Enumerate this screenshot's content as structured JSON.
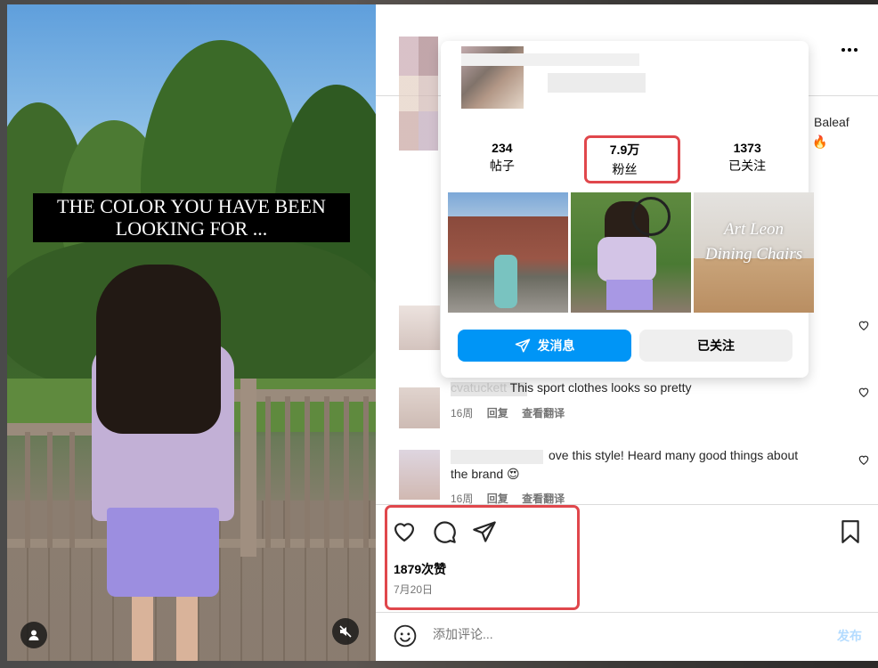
{
  "caption": {
    "line1": "THE COLOR YOU HAVE BEEN",
    "line2": "LOOKING FOR ..."
  },
  "media_buttons": {
    "tag_icon": "person-icon",
    "mute_icon": "speaker-muted-icon"
  },
  "header": {
    "more_icon": "more-dots-icon"
  },
  "hover_card": {
    "stats": [
      {
        "num": "234",
        "label": "帖子"
      },
      {
        "num": "7.9万",
        "label": "粉丝"
      },
      {
        "num": "1373",
        "label": "已关注"
      }
    ],
    "thumb3_line1": "Art Leon",
    "thumb3_line2": "Dining Chairs",
    "message_button": "发消息",
    "following_button": "已关注"
  },
  "comments": {
    "partial_right": "Baleaf",
    "c1_text": "This sport clothes looks so pretty",
    "c1_user_prefix": "cvatuckett",
    "c1_time": "16周",
    "c1_reply": "回复",
    "c1_translate": "查看翻译",
    "c2_text_line1": "ove this style! Heard many good things about",
    "c2_text_line2": "the brand 😍",
    "c2_time": "16周",
    "c2_reply": "回复",
    "c2_translate": "查看翻译"
  },
  "post": {
    "likes": "1879次赞",
    "date": "7月20日",
    "comment_placeholder": "添加评论...",
    "post_button": "发布"
  },
  "colors": {
    "accent": "#0095f6",
    "highlight": "#e0474c"
  }
}
